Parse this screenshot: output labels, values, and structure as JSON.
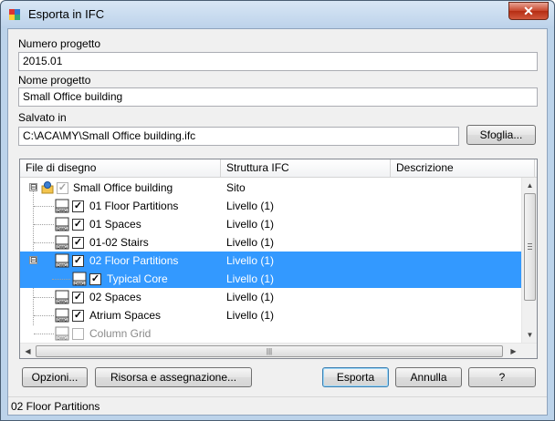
{
  "window": {
    "title": "Esporta in IFC",
    "close_glyph": "✕"
  },
  "form": {
    "project_number_label": "Numero progetto",
    "project_number_value": "2015.01",
    "project_name_label": "Nome progetto",
    "project_name_value": "Small Office building",
    "saved_in_label": "Salvato in",
    "saved_in_value": "C:\\ACA\\MY\\Small Office building.ifc",
    "browse_label": "Sfoglia..."
  },
  "grid": {
    "columns": [
      "File di disegno",
      "Struttura IFC",
      "Descrizione"
    ],
    "rows": [
      {
        "name": "Small Office building",
        "structure": "Sito",
        "description": "",
        "checked": true,
        "enabled": false,
        "icon": "project-icon",
        "expander": "⊟"
      },
      {
        "name": "01 Floor Partitions",
        "structure": "Livello (1)",
        "description": "",
        "checked": true,
        "enabled": true,
        "icon": "dwg-file-icon",
        "expander": ""
      },
      {
        "name": "01 Spaces",
        "structure": "Livello (1)",
        "description": "",
        "checked": true,
        "enabled": true,
        "icon": "dwg-file-icon",
        "expander": ""
      },
      {
        "name": "01-02 Stairs",
        "structure": "Livello (1)",
        "description": "",
        "checked": true,
        "enabled": true,
        "icon": "dwg-file-icon",
        "expander": ""
      },
      {
        "name": "02 Floor Partitions",
        "structure": "Livello (1)",
        "description": "",
        "checked": true,
        "enabled": true,
        "icon": "dwg-file-icon",
        "expander": "⊟",
        "selected": true
      },
      {
        "name": "Typical Core",
        "structure": "Livello (1)",
        "description": "",
        "checked": true,
        "enabled": true,
        "icon": "dwg-file-icon",
        "expander": "",
        "selected": true
      },
      {
        "name": "02 Spaces",
        "structure": "Livello (1)",
        "description": "",
        "checked": true,
        "enabled": true,
        "icon": "dwg-file-icon",
        "expander": ""
      },
      {
        "name": "Atrium Spaces",
        "structure": "Livello (1)",
        "description": "",
        "checked": true,
        "enabled": true,
        "icon": "dwg-file-icon",
        "expander": ""
      },
      {
        "name": "Column Grid",
        "structure": "",
        "description": "",
        "checked": false,
        "enabled": false,
        "icon": "dwg-file-icon",
        "expander": ""
      }
    ]
  },
  "buttons": {
    "options": "Opzioni...",
    "resource": "Risorsa e assegnazione...",
    "export": "Esporta",
    "cancel": "Annulla",
    "help": "?"
  },
  "status": {
    "text": "02 Floor Partitions"
  },
  "colors": {
    "selection": "#3399ff",
    "titlebar": "#bcd3ea",
    "close_button": "#c7452b"
  }
}
